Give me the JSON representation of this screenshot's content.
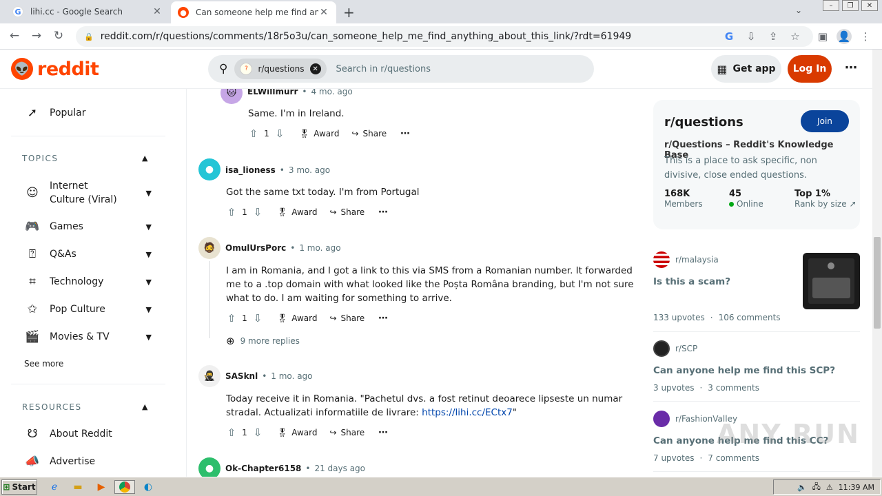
{
  "browser": {
    "tabs": [
      {
        "title": "lihi.cc - Google Search",
        "favicon": "google-icon"
      },
      {
        "title": "Can someone help me find anything",
        "favicon": "reddit-icon"
      }
    ],
    "url": "reddit.com/r/questions/comments/18r5o3u/can_someone_help_me_find_anything_about_this_link/?rdt=61949"
  },
  "header": {
    "logo_text": "reddit",
    "search_chip": "r/questions",
    "search_placeholder": "Search in r/questions",
    "get_app": "Get app",
    "login": "Log In"
  },
  "leftnav": {
    "popular": "Popular",
    "topics_heading": "TOPICS",
    "topics": [
      {
        "label": "Internet Culture (Viral)",
        "icon": "smile-icon"
      },
      {
        "label": "Games",
        "icon": "gamepad-icon"
      },
      {
        "label": "Q&As",
        "icon": "question-icon"
      },
      {
        "label": "Technology",
        "icon": "chip-icon"
      },
      {
        "label": "Pop Culture",
        "icon": "star-icon"
      },
      {
        "label": "Movies & TV",
        "icon": "clapper-icon"
      }
    ],
    "see_more": "See more",
    "resources_heading": "RESOURCES",
    "resources": [
      {
        "label": "About Reddit",
        "icon": "alien-icon"
      },
      {
        "label": "Advertise",
        "icon": "megaphone-icon"
      }
    ]
  },
  "comments": [
    {
      "user": "ELWillmurr",
      "time": "4 mo. ago",
      "text": "Same. I'm in Ireland.",
      "votes": "1",
      "avatar_color": "#c6a6e6"
    },
    {
      "user": "isa_lioness",
      "time": "3 mo. ago",
      "text": "Got the same txt today. I'm from Portugal",
      "votes": "1",
      "avatar_color": "#24c5d6"
    },
    {
      "user": "OmulUrsPorc",
      "time": "1 mo. ago",
      "text": "I am in Romania, and I got a link to this via SMS from a Romanian number. It forwarded me to a .top domain with what looked like the Poșta Româna branding, but I'm not sure what to do. I am waiting for something to arrive.",
      "votes": "1",
      "avatar_color": "#e8e2d0",
      "more_replies": "9 more replies"
    },
    {
      "user": "SASknl",
      "time": "1 mo. ago",
      "text_pre": "Today receive it in Romania. \"Pachetul dvs. a fost retinut deoarece lipseste un numar stradal. Actualizati informatiile de livrare: ",
      "link": "https://lihi.cc/ECtx7",
      "text_post": "\"",
      "votes": "1",
      "avatar_color": "#f0f0f0"
    },
    {
      "user": "Ok-Chapter6158",
      "time": "21 days ago",
      "avatar_color": "#2dbe6c"
    }
  ],
  "actions": {
    "award": "Award",
    "share": "Share"
  },
  "subreddit": {
    "name": "r/questions",
    "join": "Join",
    "title": "r/Questions – Reddit's Knowledge Base",
    "description": "This is a place to ask specific, non divisive, close ended questions.",
    "members_value": "168K",
    "members_label": "Members",
    "online_value": "45",
    "online_label": "Online",
    "rank_value": "Top 1%",
    "rank_label": "Rank by size"
  },
  "related": [
    {
      "sub": "r/malaysia",
      "title": "Is this a scam?",
      "upvotes": "133 upvotes",
      "comments": "106 comments"
    },
    {
      "sub": "r/SCP",
      "title": "Can anyone help me find this SCP?",
      "upvotes": "3 upvotes",
      "comments": "3 comments"
    },
    {
      "sub": "r/FashionValley",
      "title": "Can anyone help me find this CC?",
      "upvotes": "7 upvotes",
      "comments": "7 comments"
    }
  ],
  "taskbar": {
    "start": "Start",
    "clock": "11:39 AM"
  },
  "watermark": "ANY RUN"
}
